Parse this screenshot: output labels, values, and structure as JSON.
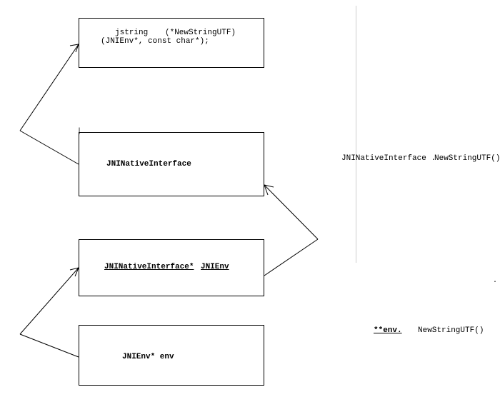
{
  "boxes": {
    "b1": {
      "line1_left": "jstring",
      "line1_right": "(*NewStringUTF)",
      "line2": "(JNIEnv*, const char*);"
    },
    "b2": {
      "text": "JNINativeInterface"
    },
    "b3": {
      "left": "JNINativeInterface*",
      "right": "JNIEnv"
    },
    "b4": {
      "text": "JNIEnv* env"
    }
  },
  "side": {
    "r1_left": "JNINativeInterface .",
    "r1_right": "NewStringUTF()",
    "r2_left": "**env.",
    "r2_right": "NewStringUTF()"
  }
}
